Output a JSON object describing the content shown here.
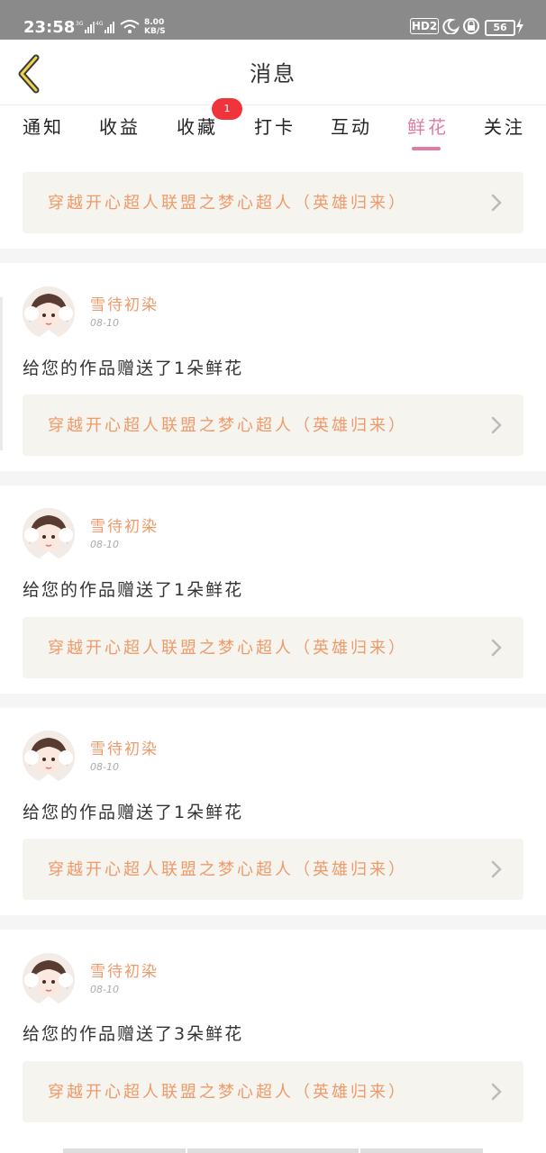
{
  "status_bar": {
    "time": "23:58",
    "net1": "3G",
    "net2": "4G",
    "speed_value": "8.00",
    "speed_unit": "KB/S",
    "hd": "HD2",
    "battery": "56"
  },
  "header": {
    "title": "消息",
    "back_icon": "chevron-left-icon"
  },
  "tabs": {
    "items": [
      {
        "label": "通知"
      },
      {
        "label": "收益"
      },
      {
        "label": "收藏",
        "badge": "1"
      },
      {
        "label": "打卡"
      },
      {
        "label": "互动"
      },
      {
        "label": "鲜花",
        "active": true
      },
      {
        "label": "关注"
      }
    ]
  },
  "top_card": {
    "text": "穿越开心超人联盟之梦心超人（英雄归来）"
  },
  "messages": [
    {
      "user": "雪待初染",
      "date": "08-10",
      "text": "给您的作品赠送了1朵鲜花",
      "work": "穿越开心超人联盟之梦心超人（英雄归来）"
    },
    {
      "user": "雪待初染",
      "date": "08-10",
      "text": "给您的作品赠送了1朵鲜花",
      "work": "穿越开心超人联盟之梦心超人（英雄归来）"
    },
    {
      "user": "雪待初染",
      "date": "08-10",
      "text": "给您的作品赠送了1朵鲜花",
      "work": "穿越开心超人联盟之梦心超人（英雄归来）"
    },
    {
      "user": "雪待初染",
      "date": "08-10",
      "text": "给您的作品赠送了3朵鲜花",
      "work": "穿越开心超人联盟之梦心超人（英雄归来）"
    }
  ],
  "colors": {
    "accent": "#e07aa6",
    "link_text": "#ee9a6a",
    "card_bg": "#f5f4ee",
    "badge": "#f0343c"
  }
}
